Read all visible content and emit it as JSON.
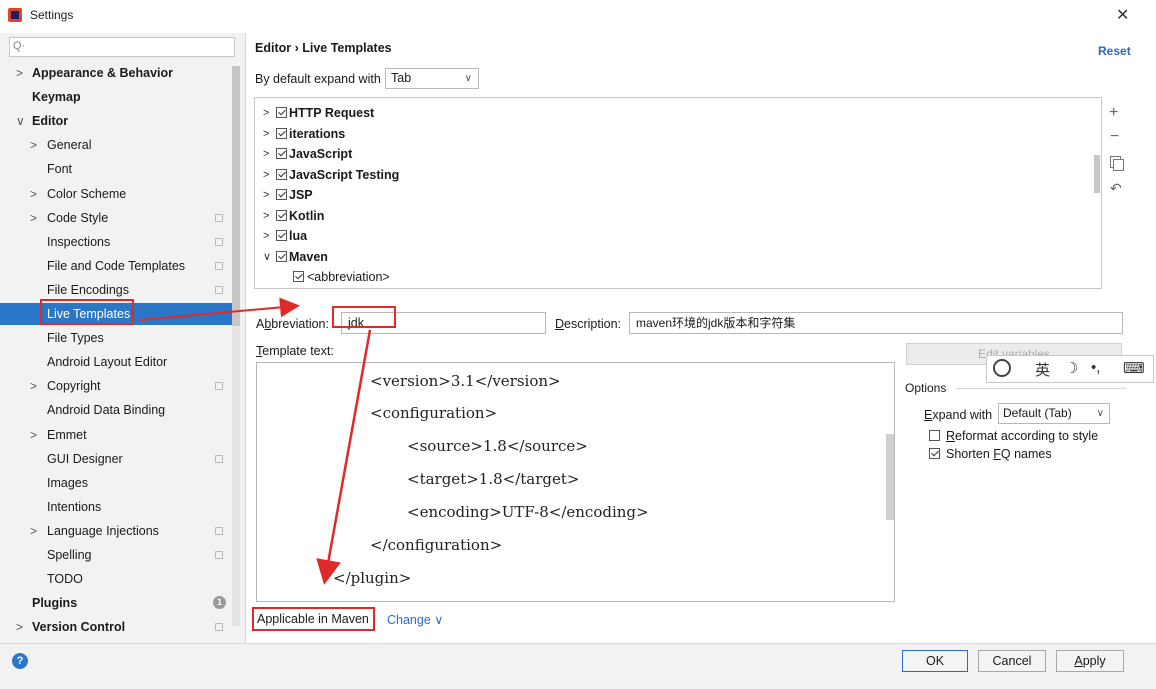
{
  "window": {
    "title": "Settings",
    "close_glyph": "✕"
  },
  "sidebar": {
    "search_placeholder": "Q·",
    "items": [
      {
        "label": "Appearance & Behavior",
        "arrow": ">"
      },
      {
        "label": "Keymap",
        "arrow": ""
      },
      {
        "label": "Editor",
        "arrow": "∨"
      },
      {
        "label": "General",
        "arrow": ">"
      },
      {
        "label": "Font",
        "arrow": ""
      },
      {
        "label": "Color Scheme",
        "arrow": ">"
      },
      {
        "label": "Code Style",
        "arrow": ">"
      },
      {
        "label": "Inspections",
        "arrow": ""
      },
      {
        "label": "File and Code Templates",
        "arrow": ""
      },
      {
        "label": "File Encodings",
        "arrow": ""
      },
      {
        "label": "Live Templates",
        "arrow": ""
      },
      {
        "label": "File Types",
        "arrow": ""
      },
      {
        "label": "Android Layout Editor",
        "arrow": ""
      },
      {
        "label": "Copyright",
        "arrow": ">"
      },
      {
        "label": "Android Data Binding",
        "arrow": ""
      },
      {
        "label": "Emmet",
        "arrow": ">"
      },
      {
        "label": "GUI Designer",
        "arrow": ""
      },
      {
        "label": "Images",
        "arrow": ""
      },
      {
        "label": "Intentions",
        "arrow": ""
      },
      {
        "label": "Language Injections",
        "arrow": ">"
      },
      {
        "label": "Spelling",
        "arrow": ""
      },
      {
        "label": "TODO",
        "arrow": ""
      },
      {
        "label": "Plugins",
        "arrow": ""
      },
      {
        "label": "Version Control",
        "arrow": ">"
      }
    ],
    "help_glyph": "?",
    "plugins_badge": "1"
  },
  "header": {
    "breadcrumb": "Editor  ›  Live Templates",
    "reset_label": "Reset"
  },
  "expand": {
    "label": "By default expand with",
    "value": "Tab",
    "dropdown_glyph": "∨"
  },
  "tree": {
    "groups": [
      {
        "label": "HTTP Request",
        "arrow": ">"
      },
      {
        "label": "iterations",
        "arrow": ">"
      },
      {
        "label": "JavaScript",
        "arrow": ">"
      },
      {
        "label": "JavaScript Testing",
        "arrow": ">"
      },
      {
        "label": "JSP",
        "arrow": ">"
      },
      {
        "label": "Kotlin",
        "arrow": ">"
      },
      {
        "label": "lua",
        "arrow": ">"
      },
      {
        "label": "Maven",
        "arrow": "∨"
      }
    ],
    "child": "<abbreviation>",
    "toolbar": {
      "add": "+",
      "remove": "−",
      "revert": "↶"
    }
  },
  "form": {
    "abbreviation_label_prefix": "A",
    "abbreviation_label_key": "b",
    "abbreviation_label_rest": "breviation:",
    "abbreviation_value": "jdk",
    "description_label_key": "D",
    "description_label_rest": "escription:",
    "description_value": "maven环境的jdk版本和字符集",
    "template_text_label_key": "T",
    "template_text_label_rest": "emplate text:",
    "template_lines": [
      "<version>3.1</version>",
      "<configuration>",
      "<source>1.8</source>",
      "<target>1.8</target>",
      "<encoding>UTF-8</encoding>",
      "</configuration>",
      "</plugin>"
    ],
    "edit_variables_label": "Edit variables"
  },
  "ime": {
    "items": [
      "英",
      "☽",
      "•,",
      "⌨"
    ]
  },
  "options": {
    "title": "Options",
    "expand_with_label_key": "E",
    "expand_with_label_rest": "xpand with",
    "expand_with_value": "Default (Tab)",
    "reformat_key": "R",
    "reformat_rest": "eformat according to style",
    "reformat_checked": false,
    "shorten_prefix": "Shorten ",
    "shorten_key": "F",
    "shorten_rest": "Q names",
    "shorten_checked": true
  },
  "context": {
    "applicable_text": "Applicable in Maven",
    "change_label": "Change ∨"
  },
  "buttons": {
    "ok": "OK",
    "cancel": "Cancel",
    "apply_key": "A",
    "apply_rest": "pply"
  },
  "colors": {
    "selection": "#2a77c7",
    "annotation_red": "#e02a2a",
    "link": "#2a6cc3"
  }
}
